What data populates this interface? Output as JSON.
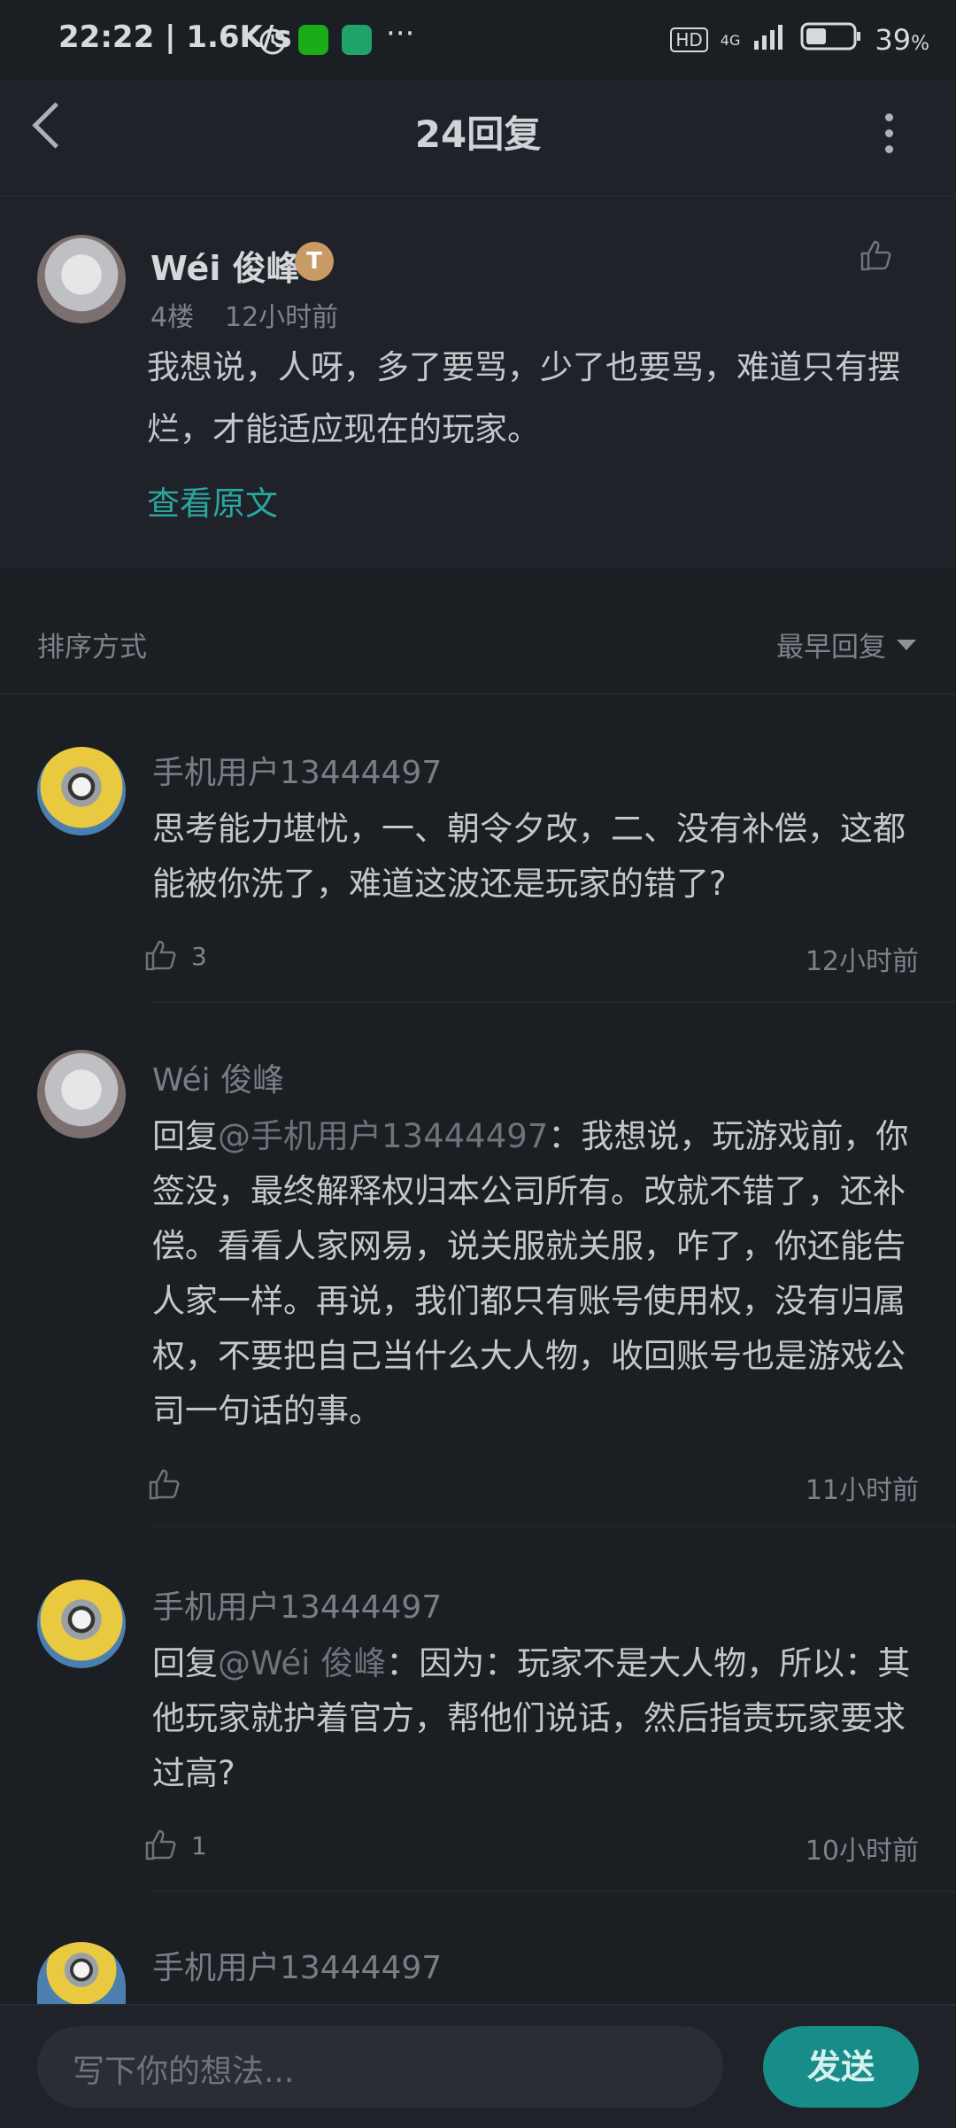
{
  "status_bar": {
    "time_speed": "22:22 | 1.6K/s",
    "more": "···",
    "hd": "HD",
    "network": "4G",
    "battery": "39",
    "battery_unit": "%"
  },
  "header": {
    "title": "24回复"
  },
  "post": {
    "author": "Wéi 俊峰",
    "badge": "T",
    "floor": "4楼",
    "time": "12小时前",
    "content": "我想说，人呀，多了要骂，少了也要骂，难道只有摆烂，才能适应现在的玩家。",
    "view_original": "查看原文"
  },
  "sort": {
    "label": "排序方式",
    "value": "最早回复"
  },
  "replies": [
    {
      "author": "手机用户13444497",
      "mention": "",
      "content": "思考能力堪忧，一、朝令夕改，二、没有补偿，这都能被你洗了，难道这波还是玩家的错了?",
      "likes": "3",
      "time": "12小时前"
    },
    {
      "author": "Wéi 俊峰",
      "prefix": "回复",
      "mention": "@手机用户13444497",
      "content": "：我想说，玩游戏前，你签没，最终解释权归本公司所有。改就不错了，还补偿。看看人家网易，说关服就关服，咋了，你还能告人家一样。再说，我们都只有账号使用权，没有归属权，不要把自己当什么大人物，收回账号也是游戏公司一句话的事。",
      "likes": "",
      "time": "11小时前"
    },
    {
      "author": "手机用户13444497",
      "prefix": "回复",
      "mention": "@Wéi 俊峰",
      "content": "：因为：玩家不是大人物，所以：其他玩家就护着官方，帮他们说话，然后指责玩家要求过高?",
      "likes": "1",
      "time": "10小时前"
    },
    {
      "author": "手机用户13444497"
    }
  ],
  "composer": {
    "placeholder": "写下你的想法...",
    "send_label": "发送"
  },
  "colors": {
    "accent": "#2aa6a1",
    "send_bg": "#178c88",
    "background": "#1b1e23"
  }
}
